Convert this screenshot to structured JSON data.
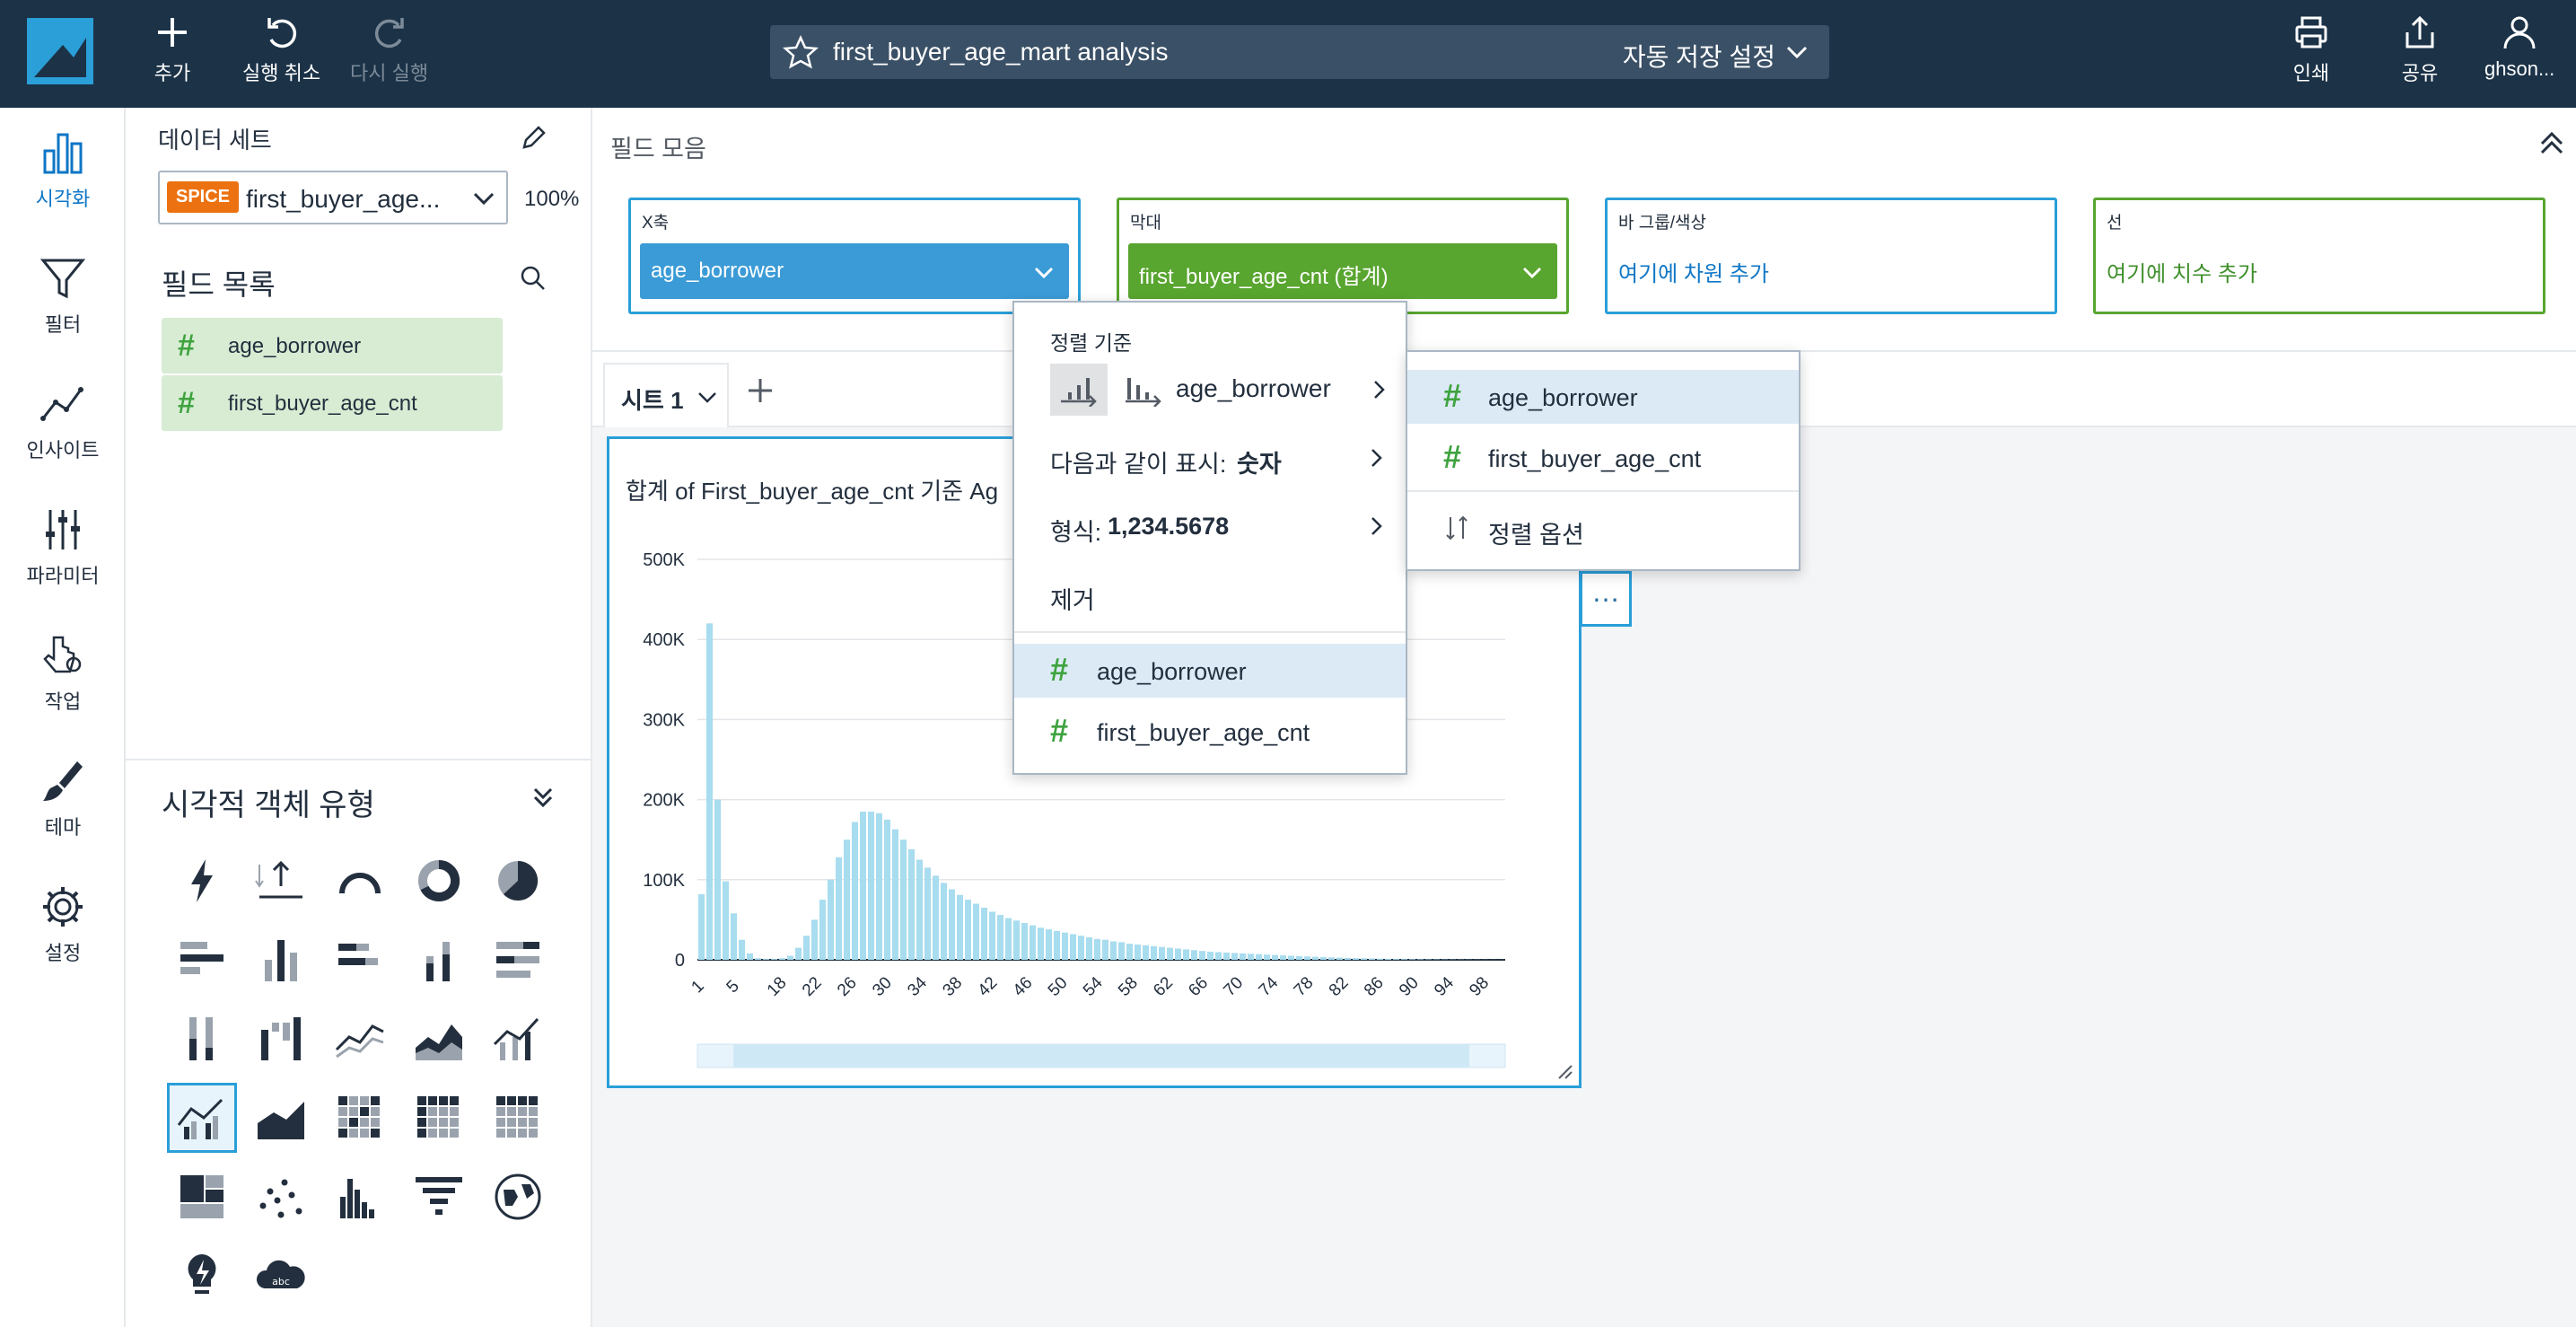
{
  "topbar": {
    "add_label": "추가",
    "undo_label": "실행 취소",
    "redo_label": "다시 실행",
    "analysis_title": "first_buyer_age_mart analysis",
    "autosave_label": "자동 저장 설정",
    "print_label": "인쇄",
    "share_label": "공유",
    "user_label": "ghson..."
  },
  "rail": {
    "items": [
      {
        "label": "시각화",
        "icon": "bar-chart-icon"
      },
      {
        "label": "필터",
        "icon": "funnel-icon"
      },
      {
        "label": "인사이트",
        "icon": "insight-icon"
      },
      {
        "label": "파라미터",
        "icon": "sliders-icon"
      },
      {
        "label": "작업",
        "icon": "action-pointer-icon"
      },
      {
        "label": "테마",
        "icon": "brush-icon"
      },
      {
        "label": "설정",
        "icon": "gear-icon"
      }
    ]
  },
  "data_panel": {
    "dataset_label": "데이터 세트",
    "spice_badge": "SPICE",
    "dataset_name": "first_buyer_age...",
    "spice_percent": "100%",
    "field_list_label": "필드 목록",
    "fields": [
      "age_borrower",
      "first_buyer_age_cnt"
    ],
    "visual_types_label": "시각적 객체 유형"
  },
  "field_wells": {
    "title": "필드 모음",
    "x_axis": {
      "title": "X축",
      "value": "age_borrower"
    },
    "bars": {
      "title": "막대",
      "value": "first_buyer_age_cnt (합계)"
    },
    "group_color": {
      "title": "바 그룹/색상",
      "placeholder": "여기에 차원 추가"
    },
    "lines": {
      "title": "선",
      "placeholder": "여기에 치수 추가"
    }
  },
  "sheets": {
    "tab1": "시트 1"
  },
  "visual": {
    "title": "합계 of First_buyer_age_cnt 기준 Ag"
  },
  "menu1": {
    "sort_by": "정렬 기준",
    "sort_field": "age_borrower",
    "show_as_label": "다음과 같이 표시:",
    "show_as_value": "숫자",
    "format_label": "형식:",
    "format_value": "1,234.5678",
    "remove": "제거",
    "fields": [
      "age_borrower",
      "first_buyer_age_cnt"
    ]
  },
  "menu2": {
    "fields": [
      "age_borrower",
      "first_buyer_age_cnt"
    ],
    "sort_options": "정렬 옵션"
  },
  "colors": {
    "topbar": "#1b3247",
    "accent_blue": "#2a9fd8",
    "green": "#58a52f",
    "bar": "#a8dcef"
  },
  "chart_data": {
    "type": "bar",
    "x": [
      1,
      2,
      3,
      4,
      5,
      6,
      7,
      8,
      9,
      10,
      11,
      12,
      13,
      14,
      15,
      16,
      17,
      18,
      19,
      20,
      21,
      22,
      23,
      24,
      25,
      26,
      27,
      28,
      29,
      30,
      31,
      32,
      33,
      34,
      35,
      36,
      37,
      38,
      39,
      40,
      41,
      42,
      43,
      44,
      45,
      46,
      47,
      48,
      49,
      50,
      51,
      52,
      53,
      54,
      55,
      56,
      57,
      58,
      59,
      60,
      61,
      62,
      63,
      64,
      65,
      66,
      67,
      68,
      69,
      70,
      71,
      72,
      73,
      74,
      75,
      76,
      77,
      78,
      79,
      80,
      81,
      82,
      83,
      84,
      85,
      86,
      87,
      88,
      89,
      90,
      91,
      92,
      93,
      94,
      95,
      96,
      97,
      98,
      99,
      100
    ],
    "values": [
      82000,
      420000,
      200000,
      98000,
      58000,
      25000,
      8000,
      2000,
      1000,
      1000,
      2000,
      5000,
      15000,
      30000,
      50000,
      75000,
      100000,
      128000,
      150000,
      172000,
      185000,
      185000,
      183000,
      175000,
      163000,
      150000,
      138000,
      125000,
      115000,
      105000,
      96000,
      88000,
      81000,
      75000,
      70000,
      65000,
      60000,
      56000,
      52000,
      49000,
      46000,
      43000,
      40000,
      38000,
      36000,
      34000,
      32000,
      30000,
      28000,
      26000,
      25000,
      23000,
      22000,
      20000,
      19000,
      18000,
      17000,
      16000,
      15000,
      14000,
      13000,
      12000,
      11000,
      10000,
      9500,
      9000,
      8500,
      8000,
      7500,
      7000,
      6500,
      6000,
      5500,
      5000,
      4500,
      4200,
      3800,
      3500,
      3000,
      2700,
      2400,
      2100,
      1800,
      1600,
      1400,
      1200,
      1000,
      900,
      800,
      700,
      600,
      500,
      400,
      350,
      300,
      250,
      200,
      150,
      100,
      80
    ],
    "x_ticks": [
      "1",
      "5",
      "18",
      "22",
      "26",
      "30",
      "34",
      "38",
      "42",
      "46",
      "50",
      "54",
      "58",
      "62",
      "66",
      "70",
      "74",
      "78",
      "82",
      "86",
      "90",
      "94",
      "98"
    ],
    "y_ticks": [
      "0",
      "100K",
      "200K",
      "300K",
      "400K",
      "500K"
    ],
    "ylim": [
      0,
      500000
    ],
    "grid": true
  }
}
